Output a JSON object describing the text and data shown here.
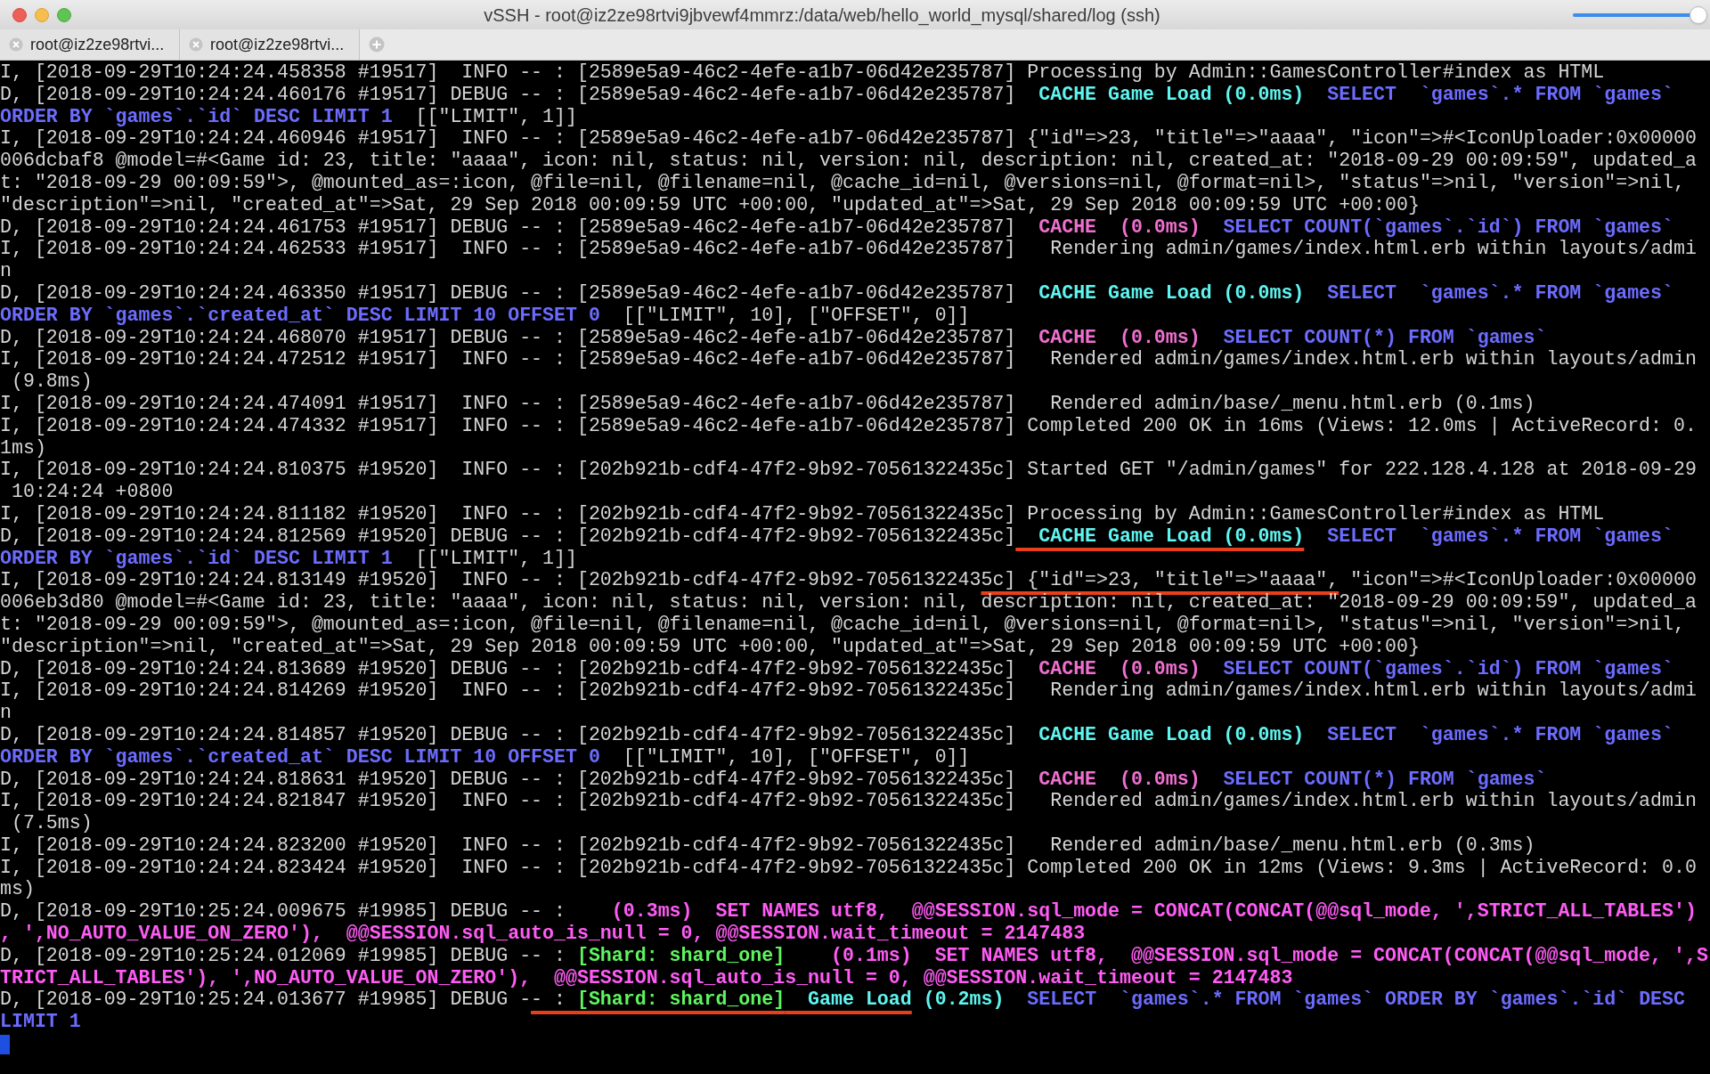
{
  "window": {
    "title": "vSSH - root@iz2ze98rtvi9jbvewf4mmrz:/data/web/hello_world_mysql/shared/log (ssh)"
  },
  "opacity_slider": {
    "level": 0.94
  },
  "tabs": [
    {
      "label": "root@iz2ze98rtvi...",
      "selected": false
    },
    {
      "label": "root@iz2ze98rtvi...",
      "selected": false
    }
  ],
  "terminal": {
    "lines": [
      [
        {
          "kind": "plain",
          "text": "I, [2018-09-29T10:24:24.458358 #19517]  INFO -- : [2589e5a9-46c2-4efe-a1b7-06d42e235787] Processing by Admin::GamesController#index as HTML"
        }
      ],
      [
        {
          "kind": "plain",
          "text": "D, [2018-09-29T10:24:24.460176 #19517] DEBUG -- : [2589e5a9-46c2-4efe-a1b7-06d42e235787]  "
        },
        {
          "kind": "cyan",
          "text": "CACHE Game Load (0.0ms)"
        },
        {
          "kind": "blue",
          "text": "  SELECT  `games`.* FROM `games`"
        }
      ],
      [
        {
          "kind": "blue",
          "text": "ORDER BY `games`.`id` DESC LIMIT 1"
        },
        {
          "kind": "plain",
          "text": "  [[\"LIMIT\", 1]]"
        }
      ],
      [
        {
          "kind": "plain",
          "text": "I, [2018-09-29T10:24:24.460946 #19517]  INFO -- : [2589e5a9-46c2-4efe-a1b7-06d42e235787] {\"id\"=>23, \"title\"=>\"aaaa\", \"icon\"=>#<IconUploader:0x00000"
        }
      ],
      [
        {
          "kind": "plain",
          "text": "006dcbaf8 @model=#<Game id: 23, title: \"aaaa\", icon: nil, status: nil, version: nil, description: nil, created_at: \"2018-09-29 00:09:59\", updated_a"
        }
      ],
      [
        {
          "kind": "plain",
          "text": "t: \"2018-09-29 00:09:59\">, @mounted_as=:icon, @file=nil, @filename=nil, @cache_id=nil, @versions=nil, @format=nil>, \"status\"=>nil, \"version\"=>nil,"
        }
      ],
      [
        {
          "kind": "plain",
          "text": "\"description\"=>nil, \"created_at\"=>Sat, 29 Sep 2018 00:09:59 UTC +00:00, \"updated_at\"=>Sat, 29 Sep 2018 00:09:59 UTC +00:00}"
        }
      ],
      [
        {
          "kind": "plain",
          "text": "D, [2018-09-29T10:24:24.461753 #19517] DEBUG -- : [2589e5a9-46c2-4efe-a1b7-06d42e235787]  "
        },
        {
          "kind": "pink",
          "text": "CACHE  (0.0ms)"
        },
        {
          "kind": "blue",
          "text": "  SELECT COUNT(`games`.`id`) FROM `games`"
        }
      ],
      [
        {
          "kind": "plain",
          "text": "I, [2018-09-29T10:24:24.462533 #19517]  INFO -- : [2589e5a9-46c2-4efe-a1b7-06d42e235787]   Rendering admin/games/index.html.erb within layouts/admi"
        }
      ],
      [
        {
          "kind": "plain",
          "text": "n"
        }
      ],
      [
        {
          "kind": "plain",
          "text": "D, [2018-09-29T10:24:24.463350 #19517] DEBUG -- : [2589e5a9-46c2-4efe-a1b7-06d42e235787]  "
        },
        {
          "kind": "cyan",
          "text": "CACHE Game Load (0.0ms)"
        },
        {
          "kind": "blue",
          "text": "  SELECT  `games`.* FROM `games`"
        }
      ],
      [
        {
          "kind": "blue",
          "text": "ORDER BY `games`.`created_at` DESC LIMIT 10 OFFSET 0"
        },
        {
          "kind": "plain",
          "text": "  [[\"LIMIT\", 10], [\"OFFSET\", 0]]"
        }
      ],
      [
        {
          "kind": "plain",
          "text": "D, [2018-09-29T10:24:24.468070 #19517] DEBUG -- : [2589e5a9-46c2-4efe-a1b7-06d42e235787]  "
        },
        {
          "kind": "pink",
          "text": "CACHE  (0.0ms)"
        },
        {
          "kind": "blue",
          "text": "  SELECT COUNT(*) FROM `games`"
        }
      ],
      [
        {
          "kind": "plain",
          "text": "I, [2018-09-29T10:24:24.472512 #19517]  INFO -- : [2589e5a9-46c2-4efe-a1b7-06d42e235787]   Rendered admin/games/index.html.erb within layouts/admin"
        }
      ],
      [
        {
          "kind": "plain",
          "text": " (9.8ms)"
        }
      ],
      [
        {
          "kind": "plain",
          "text": "I, [2018-09-29T10:24:24.474091 #19517]  INFO -- : [2589e5a9-46c2-4efe-a1b7-06d42e235787]   Rendered admin/base/_menu.html.erb (0.1ms)"
        }
      ],
      [
        {
          "kind": "plain",
          "text": "I, [2018-09-29T10:24:24.474332 #19517]  INFO -- : [2589e5a9-46c2-4efe-a1b7-06d42e235787] Completed 200 OK in 16ms (Views: 12.0ms | ActiveRecord: 0."
        }
      ],
      [
        {
          "kind": "plain",
          "text": "1ms)"
        }
      ],
      [
        {
          "kind": "plain",
          "text": "I, [2018-09-29T10:24:24.810375 #19520]  INFO -- : [202b921b-cdf4-47f2-9b92-70561322435c] Started GET \"/admin/games\" for 222.128.4.128 at 2018-09-29"
        }
      ],
      [
        {
          "kind": "plain",
          "text": " 10:24:24 +0800"
        }
      ],
      [
        {
          "kind": "plain",
          "text": "I, [2018-09-29T10:24:24.811182 #19520]  INFO -- : [202b921b-cdf4-47f2-9b92-70561322435c] Processing by Admin::GamesController#index as HTML"
        }
      ],
      [
        {
          "kind": "plain",
          "text": "D, [2018-09-29T10:24:24.812569 #19520] DEBUG -- : [202b921b-cdf4-47f2-9b92-70561322435c]"
        },
        {
          "kind": "cyan",
          "text": "  CACHE Game Load (0.0ms)",
          "underlined": true
        },
        {
          "kind": "blue",
          "text": "  SELECT  `games`.* FROM `games`"
        }
      ],
      [
        {
          "kind": "blue",
          "text": "ORDER BY `games`.`id` DESC LIMIT 1"
        },
        {
          "kind": "plain",
          "text": "  [[\"LIMIT\", 1]]"
        }
      ],
      [
        {
          "kind": "plain",
          "text": "I, [2018-09-29T10:24:24.813149 #19520]  INFO -- : [202b921b-cdf4-47f2-9b92-7056132243"
        },
        {
          "kind": "plain",
          "text": "5c] {\"id\"=>23, \"title\"=>\"aaaa\",",
          "underlined": true
        },
        {
          "kind": "plain",
          "text": " \"icon\"=>#<IconUploader:0x00000"
        }
      ],
      [
        {
          "kind": "plain",
          "text": "006eb3d80 @model=#<Game id: 23, title: \"aaaa\", icon: nil, status: nil, version: nil, description: nil, created_at: \"2018-09-29 00:09:59\", updated_a"
        }
      ],
      [
        {
          "kind": "plain",
          "text": "t: \"2018-09-29 00:09:59\">, @mounted_as=:icon, @file=nil, @filename=nil, @cache_id=nil, @versions=nil, @format=nil>, \"status\"=>nil, \"version\"=>nil,"
        }
      ],
      [
        {
          "kind": "plain",
          "text": "\"description\"=>nil, \"created_at\"=>Sat, 29 Sep 2018 00:09:59 UTC +00:00, \"updated_at\"=>Sat, 29 Sep 2018 00:09:59 UTC +00:00}"
        }
      ],
      [
        {
          "kind": "plain",
          "text": "D, [2018-09-29T10:24:24.813689 #19520] DEBUG -- : [202b921b-cdf4-47f2-9b92-70561322435c]  "
        },
        {
          "kind": "pink",
          "text": "CACHE  (0.0ms)"
        },
        {
          "kind": "blue",
          "text": "  SELECT COUNT(`games`.`id`) FROM `games`"
        }
      ],
      [
        {
          "kind": "plain",
          "text": "I, [2018-09-29T10:24:24.814269 #19520]  INFO -- : [202b921b-cdf4-47f2-9b92-70561322435c]   Rendering admin/games/index.html.erb within layouts/admi"
        }
      ],
      [
        {
          "kind": "plain",
          "text": "n"
        }
      ],
      [
        {
          "kind": "plain",
          "text": "D, [2018-09-29T10:24:24.814857 #19520] DEBUG -- : [202b921b-cdf4-47f2-9b92-70561322435c]  "
        },
        {
          "kind": "cyan",
          "text": "CACHE Game Load (0.0ms)"
        },
        {
          "kind": "blue",
          "text": "  SELECT  `games`.* FROM `games`"
        }
      ],
      [
        {
          "kind": "blue",
          "text": "ORDER BY `games`.`created_at` DESC LIMIT 10 OFFSET 0"
        },
        {
          "kind": "plain",
          "text": "  [[\"LIMIT\", 10], [\"OFFSET\", 0]]"
        }
      ],
      [
        {
          "kind": "plain",
          "text": "D, [2018-09-29T10:24:24.818631 #19520] DEBUG -- : [202b921b-cdf4-47f2-9b92-70561322435c]  "
        },
        {
          "kind": "pink",
          "text": "CACHE  (0.0ms)"
        },
        {
          "kind": "blue",
          "text": "  SELECT COUNT(*) FROM `games`"
        }
      ],
      [
        {
          "kind": "plain",
          "text": "I, [2018-09-29T10:24:24.821847 #19520]  INFO -- : [202b921b-cdf4-47f2-9b92-70561322435c]   Rendered admin/games/index.html.erb within layouts/admin"
        }
      ],
      [
        {
          "kind": "plain",
          "text": " (7.5ms)"
        }
      ],
      [
        {
          "kind": "plain",
          "text": "I, [2018-09-29T10:24:24.823200 #19520]  INFO -- : [202b921b-cdf4-47f2-9b92-70561322435c]   Rendered admin/base/_menu.html.erb (0.3ms)"
        }
      ],
      [
        {
          "kind": "plain",
          "text": "I, [2018-09-29T10:24:24.823424 #19520]  INFO -- : [202b921b-cdf4-47f2-9b92-70561322435c] Completed 200 OK in 12ms (Views: 9.3ms | ActiveRecord: 0.0"
        }
      ],
      [
        {
          "kind": "plain",
          "text": "ms)"
        }
      ],
      [
        {
          "kind": "plain",
          "text": "D, [2018-09-29T10:25:24.009675 #19985] DEBUG -- :    "
        },
        {
          "kind": "magenta",
          "text": "(0.3ms)  SET NAMES utf8,  @@SESSION.sql_mode = CONCAT(CONCAT(@@sql_mode, ',STRICT_ALL_TABLES')"
        }
      ],
      [
        {
          "kind": "magenta",
          "text": ", ',NO_AUTO_VALUE_ON_ZERO'),  @@SESSION.sql_auto_is_null = 0, @@SESSION.wait_timeout = 2147483"
        }
      ],
      [
        {
          "kind": "plain",
          "text": "D, [2018-09-29T10:25:24.012069 #19985] DEBUG -- : "
        },
        {
          "kind": "green",
          "text": "[Shard: shard_one]"
        },
        {
          "kind": "magenta",
          "text": "    (0.1ms)  SET NAMES utf8,  @@SESSION.sql_mode = CONCAT(CONCAT(@@sql_mode, ',S"
        }
      ],
      [
        {
          "kind": "magenta",
          "text": "TRICT_ALL_TABLES'), ',NO_AUTO_VALUE_ON_ZERO'),  @@SESSION.sql_auto_is_null = 0, @@SESSION.wait_timeout = 2147483"
        }
      ],
      [
        {
          "kind": "plain",
          "text": "D, [2018-09-29T10:25:24.013677 #19985] DEBUG -"
        },
        {
          "kind": "plain",
          "text": "- : ",
          "underlined": true
        },
        {
          "kind": "green",
          "text": "[Shard: shard_one]",
          "underlined": true
        },
        {
          "kind": "cyan",
          "text": "  Game Load",
          "underlined": true
        },
        {
          "kind": "cyan",
          "text": " (0.2ms)"
        },
        {
          "kind": "blue",
          "text": "  SELECT  `games`.* FROM `games` ORDER BY `games`.`id` DESC"
        }
      ],
      [
        {
          "kind": "blue",
          "text": "LIMIT 1"
        }
      ]
    ]
  }
}
